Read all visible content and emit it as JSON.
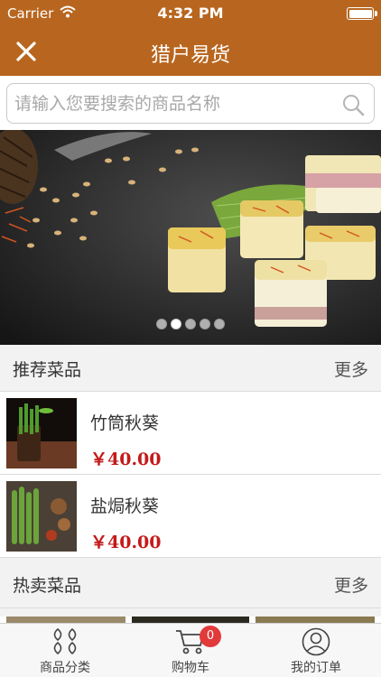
{
  "status_bar": {
    "carrier": "Carrier",
    "time": "4:32 PM"
  },
  "nav": {
    "title": "猎户易货",
    "close_icon": "close-icon"
  },
  "search": {
    "placeholder": "请输入您要搜索的商品名称",
    "icon": "search-icon"
  },
  "banner": {
    "page_count": 5,
    "active_index": 1
  },
  "recommended": {
    "title": "推荐菜品",
    "more": "更多",
    "items": [
      {
        "name": "竹筒秋葵",
        "price": "￥40.00"
      },
      {
        "name": "盐焗秋葵",
        "price": "￥40.00"
      }
    ]
  },
  "hot": {
    "title": "热卖菜品",
    "more": "更多"
  },
  "tabs": [
    {
      "label": "商品分类",
      "icon": "category-icon"
    },
    {
      "label": "购物车",
      "icon": "cart-icon",
      "badge": "0"
    },
    {
      "label": "我的订单",
      "icon": "user-icon"
    }
  ],
  "colors": {
    "brand": "#b8661f",
    "price": "#c41a1a",
    "badge": "#e2393b"
  }
}
